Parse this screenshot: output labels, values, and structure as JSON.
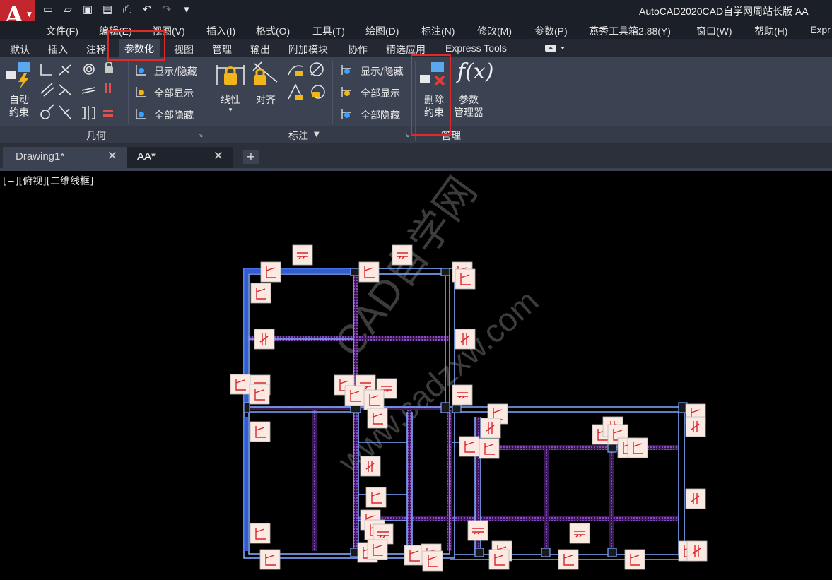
{
  "app": {
    "logo_letter": "A",
    "title": "AutoCAD2020CAD自学网周站长版   AA"
  },
  "qat_icons": [
    "new-icon",
    "open-icon",
    "save-icon",
    "saveas-icon",
    "print-icon",
    "undo-icon",
    "redo-icon",
    "customize-icon"
  ],
  "menu": [
    "文件(F)",
    "编辑(E)",
    "视图(V)",
    "插入(I)",
    "格式(O)",
    "工具(T)",
    "绘图(D)",
    "标注(N)",
    "修改(M)",
    "参数(P)",
    "燕秀工具箱2.88(Y)",
    "窗口(W)",
    "帮助(H)",
    "Expr"
  ],
  "ribbon_tabs": [
    "默认",
    "插入",
    "注释",
    "参数化",
    "视图",
    "管理",
    "输出",
    "附加模块",
    "协作",
    "精选应用",
    "Express Tools"
  ],
  "active_ribbon_tab": "参数化",
  "ribbon": {
    "geometry": {
      "auto_constrain": [
        "自动",
        "约束"
      ],
      "show_hide": "显示/隐藏",
      "show_all": "全部显示",
      "hide_all": "全部隐藏",
      "label": "几何"
    },
    "dimensional": {
      "linear": "线性",
      "aligned": "对齐",
      "show_hide": "显示/隐藏",
      "show_all": "全部显示",
      "hide_all": "全部隐藏",
      "label": "标注"
    },
    "manage": {
      "delete_constraints": [
        "删除",
        "约束"
      ],
      "param_manager": [
        "参数",
        "管理器"
      ],
      "fx_glyph": "f(x)",
      "label": "管理"
    }
  },
  "doc_tabs": [
    {
      "label": "Drawing1*",
      "active": false
    },
    {
      "label": "AA*",
      "active": true
    }
  ],
  "viewport_label": "[−][俯视][二维线框]",
  "watermark": [
    "CAD自学网",
    "www.cadzxw.com"
  ],
  "colors": {
    "accent_red": "#e02a2a",
    "wall_blue": "#8ab4ff",
    "grid_purple": "#7a3ea8",
    "constraint_bg": "#fbe9e2",
    "constraint_stroke": "#d7262e"
  }
}
